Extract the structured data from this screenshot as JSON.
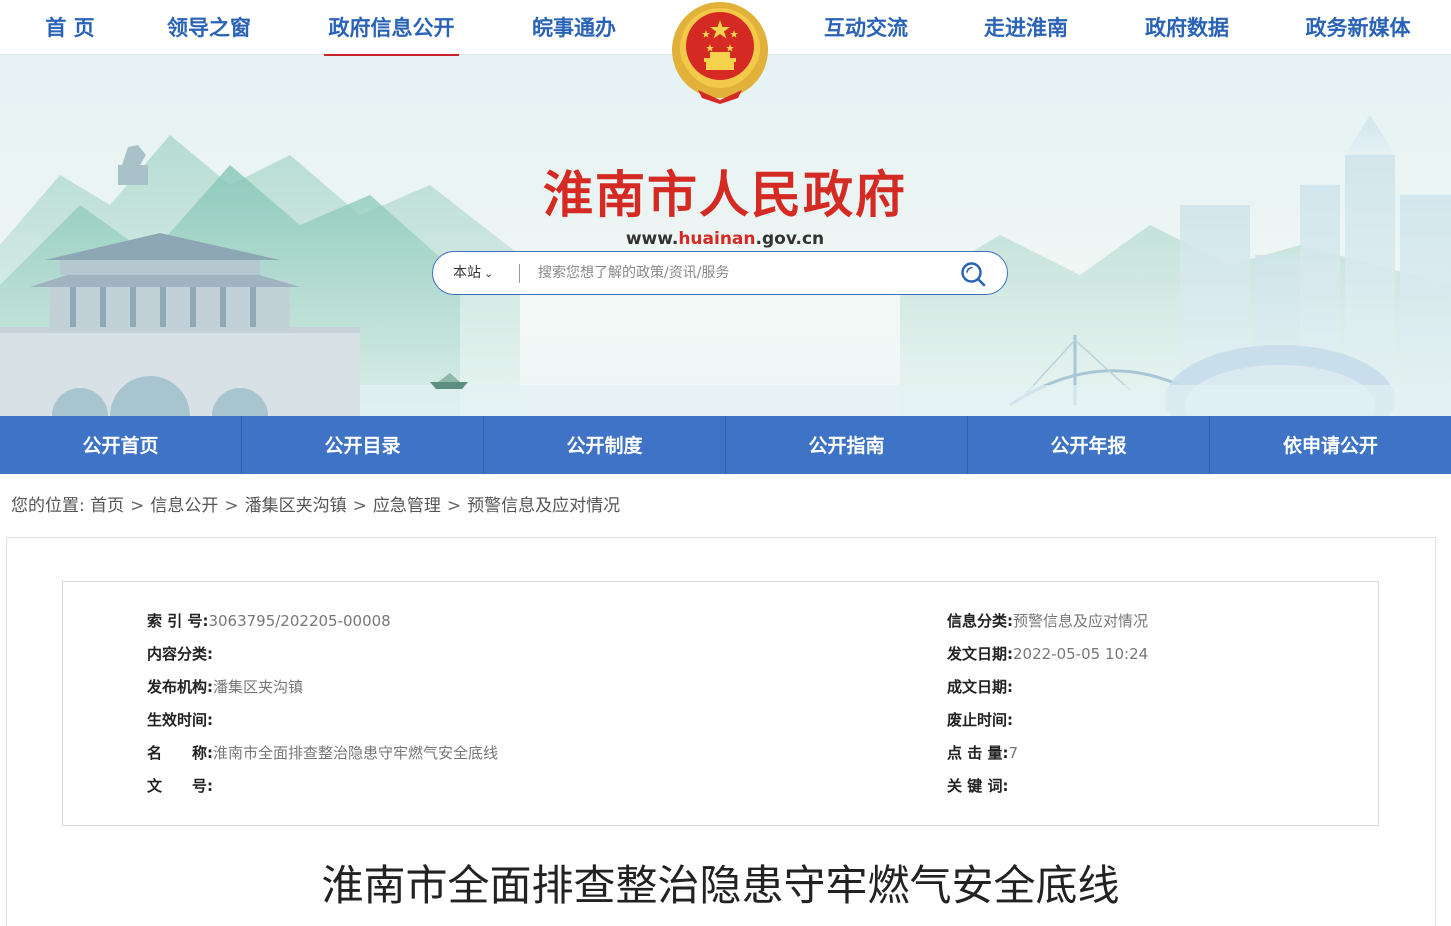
{
  "topnav": {
    "items": [
      "首 页",
      "领导之窗",
      "政府信息公开",
      "皖事通办",
      "互动交流",
      "走进淮南",
      "政府数据",
      "政务新媒体"
    ]
  },
  "banner": {
    "title": "淮南市人民政府",
    "url_prefix": "www.",
    "url_highlight": "huainan",
    "url_suffix": ".gov.cn"
  },
  "search": {
    "scope": "本站",
    "placeholder": "搜索您想了解的政策/资讯/服务"
  },
  "subnav": {
    "items": [
      "公开首页",
      "公开目录",
      "公开制度",
      "公开指南",
      "公开年报",
      "依申请公开"
    ]
  },
  "breadcrumb": {
    "label": "您的位置:",
    "items": [
      "首页",
      "信息公开",
      "潘集区夹沟镇",
      "应急管理",
      "预警信息及应对情况"
    ]
  },
  "meta": {
    "index_no_label": "索 引 号:",
    "index_no": "3063795/202205-00008",
    "category_label": "信息分类:",
    "category": "预警信息及应对情况",
    "content_class_label": "内容分类:",
    "content_class": "",
    "publish_date_label": "发文日期:",
    "publish_date": "2022-05-05 10:24",
    "publisher_label": "发布机构:",
    "publisher": "潘集区夹沟镇",
    "created_label": "成文日期:",
    "created": "",
    "effective_label": "生效时间:",
    "effective": "",
    "expire_label": "废止时间:",
    "expire": "",
    "name_label": "名　　称:",
    "name": "淮南市全面排查整治隐患守牢燃气安全底线",
    "clicks_label": "点 击 量:",
    "clicks": "7",
    "doc_no_label": "文　　号:",
    "doc_no": "",
    "keywords_label": "关 键 词:",
    "keywords": ""
  },
  "article": {
    "title": "淮南市全面排查整治隐患守牢燃气安全底线"
  },
  "colors": {
    "brand_blue": "#3f73c5",
    "nav_blue": "#2a63b6",
    "title_red": "#d42a23"
  }
}
